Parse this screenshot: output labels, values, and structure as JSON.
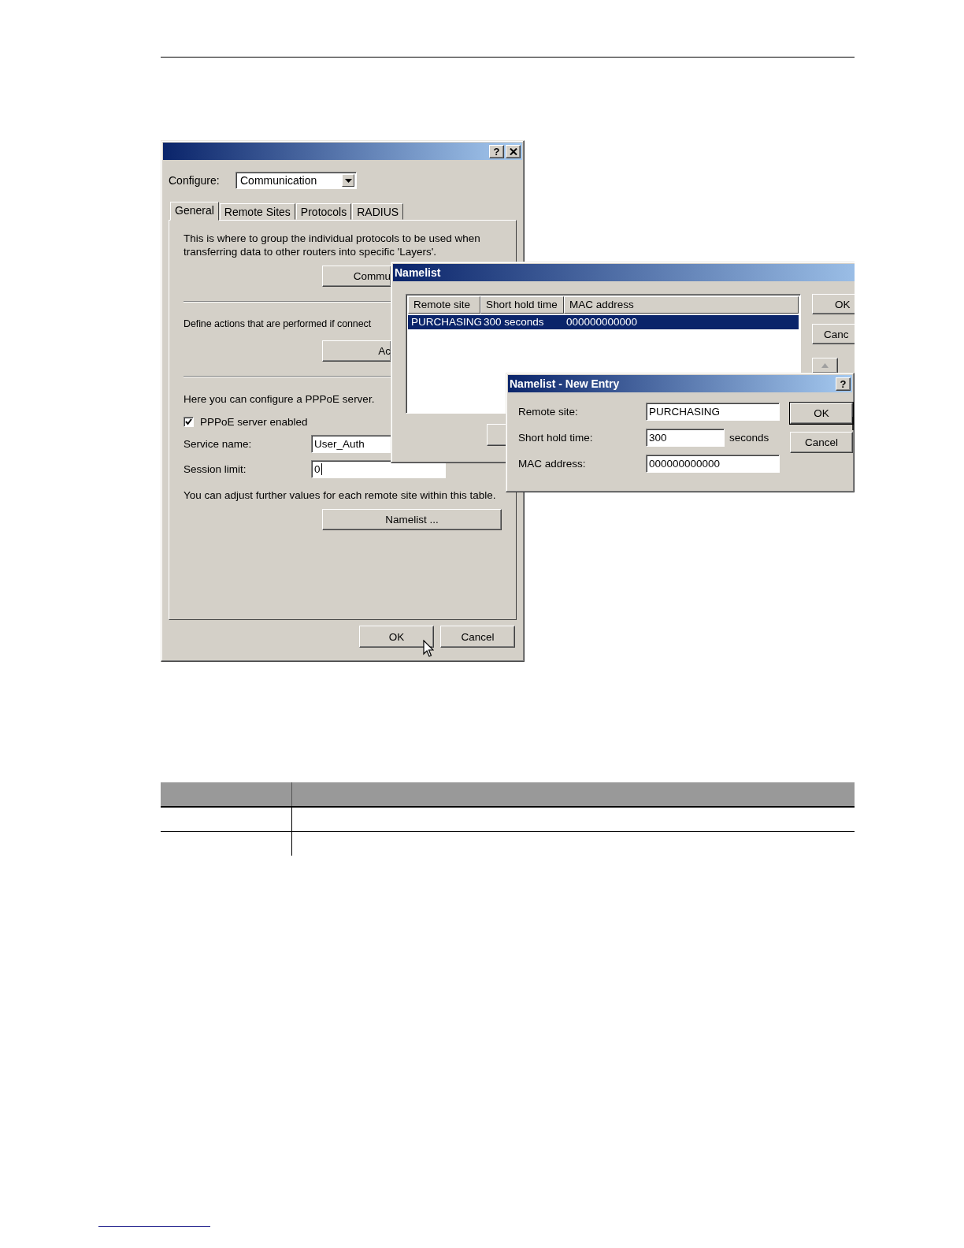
{
  "main_dialog": {
    "help_label": "?",
    "configure_label": "Configure:",
    "configure_value": "Communication",
    "tabs": [
      {
        "label": "General",
        "selected": true
      },
      {
        "label": "Remote Sites",
        "selected": false
      },
      {
        "label": "Protocols",
        "selected": false
      },
      {
        "label": "RADIUS",
        "selected": false
      }
    ],
    "layers_text": "This is where to group the individual protocols to be used when transferring data to other routers into specific 'Layers'.",
    "layers_button": "Commu",
    "actions_text": "Define actions that are performed if connect",
    "actions_button": "Ac",
    "pppoe_text": "Here you can configure a PPPoE server.",
    "pppoe_enabled": {
      "label": "PPPoE server enabled",
      "checked": true
    },
    "service_name": {
      "label": "Service name:",
      "value": "User_Auth"
    },
    "session_limit": {
      "label": "Session limit:",
      "value": "0"
    },
    "namelist_text": "You can adjust further values for each remote site within this table.",
    "namelist_button": "Namelist ...",
    "buttons": [
      "OK",
      "Cancel"
    ]
  },
  "namelist_dialog": {
    "title": "Namelist",
    "columns": [
      "Remote site",
      "Short hold time",
      "MAC address"
    ],
    "rows": [
      {
        "cells": [
          "PURCHASING",
          "300 seconds",
          "000000000000"
        ],
        "selected": true
      }
    ],
    "buttons": [
      "OK",
      "Canc"
    ]
  },
  "new_entry_dialog": {
    "title": "Namelist - New Entry",
    "help_label": "?",
    "fields": [
      {
        "label": "Remote site:",
        "value": "PURCHASING"
      },
      {
        "label": "Short hold time:",
        "value": "300",
        "unit": "seconds"
      },
      {
        "label": "MAC address:",
        "value": "000000000000"
      }
    ],
    "buttons": [
      "OK",
      "Cancel"
    ]
  }
}
